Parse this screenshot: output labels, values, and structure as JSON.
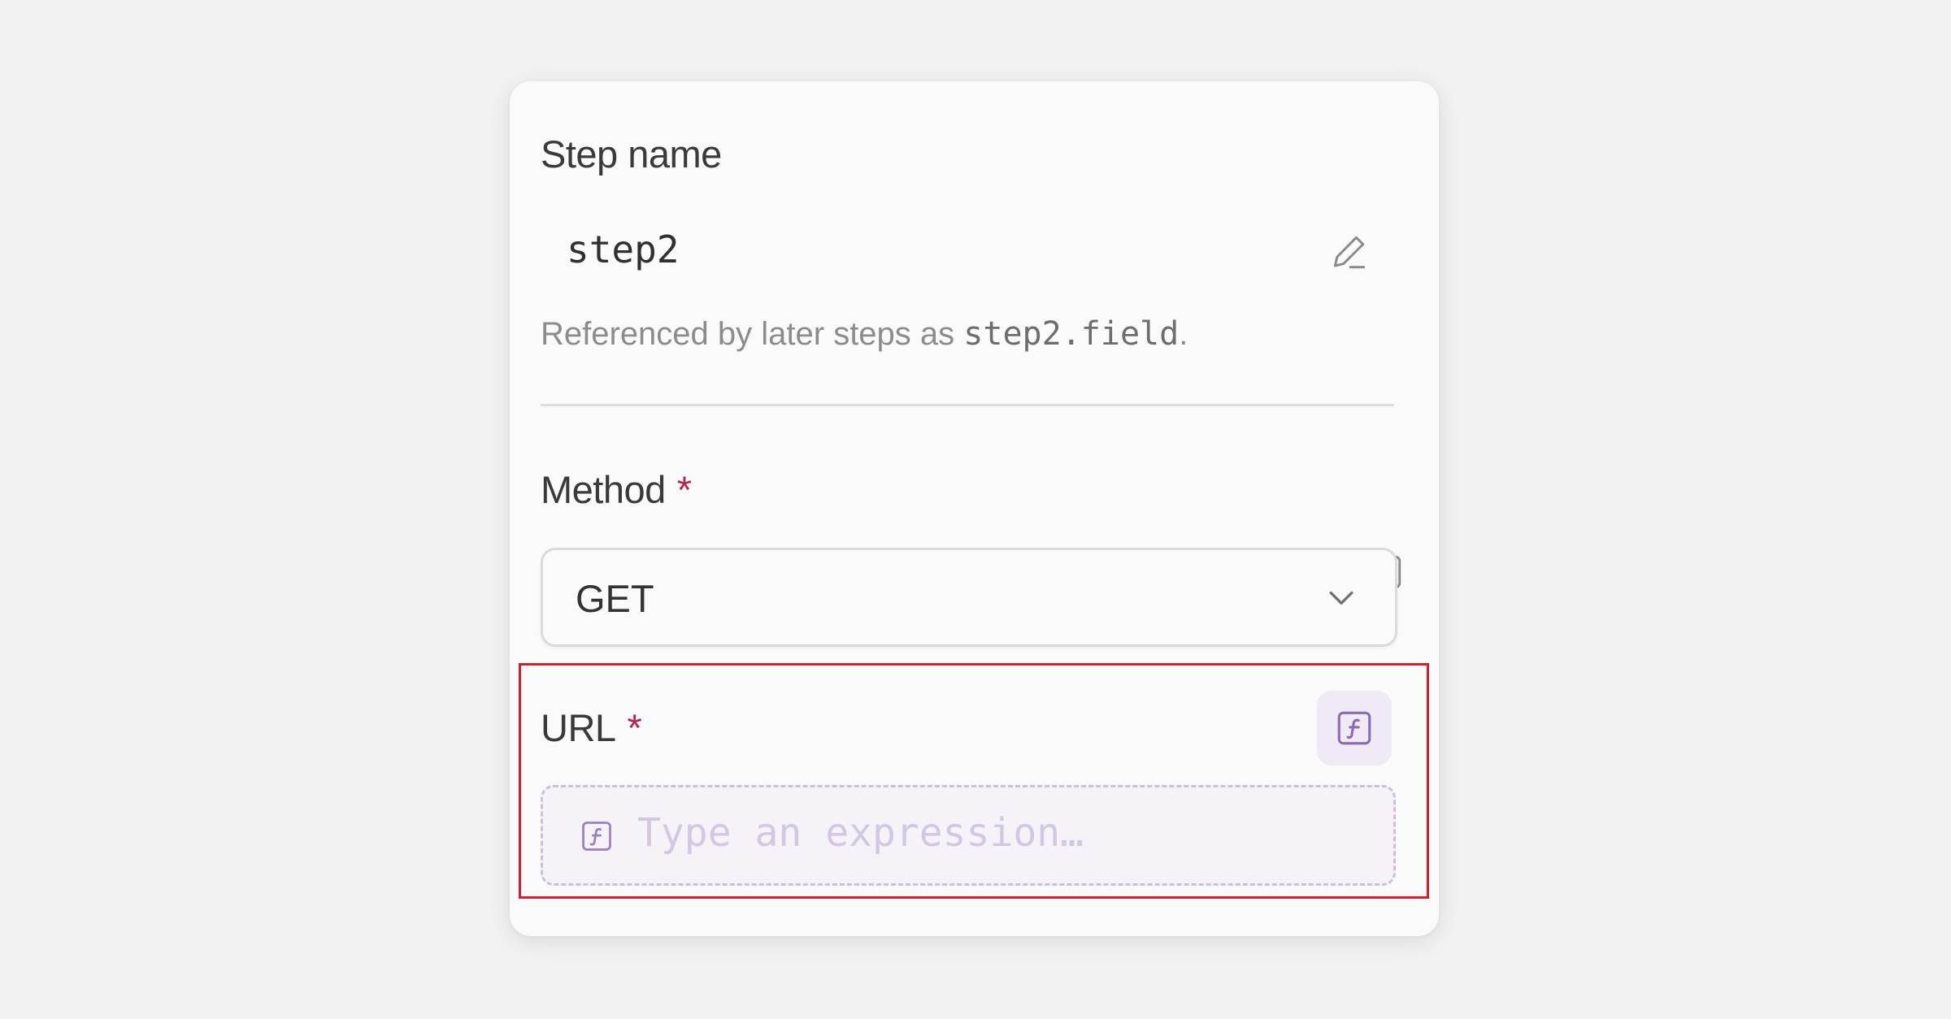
{
  "step": {
    "label": "Step name",
    "value": "step2",
    "help_prefix": "Referenced by later steps as ",
    "help_code": "step2.field",
    "help_suffix": ".",
    "edit_icon": "pencil-icon"
  },
  "method": {
    "label": "Method",
    "required_mark": "*",
    "selected": "GET",
    "fx_icon": "function-icon",
    "dropdown_icon": "chevron-down-icon"
  },
  "url": {
    "label": "URL",
    "required_mark": "*",
    "placeholder": "Type an expression…",
    "fx_icon": "function-icon"
  },
  "colors": {
    "required": "#b0254f",
    "expression_accent": "#8a6bb8",
    "highlight_border": "#d61f28"
  }
}
